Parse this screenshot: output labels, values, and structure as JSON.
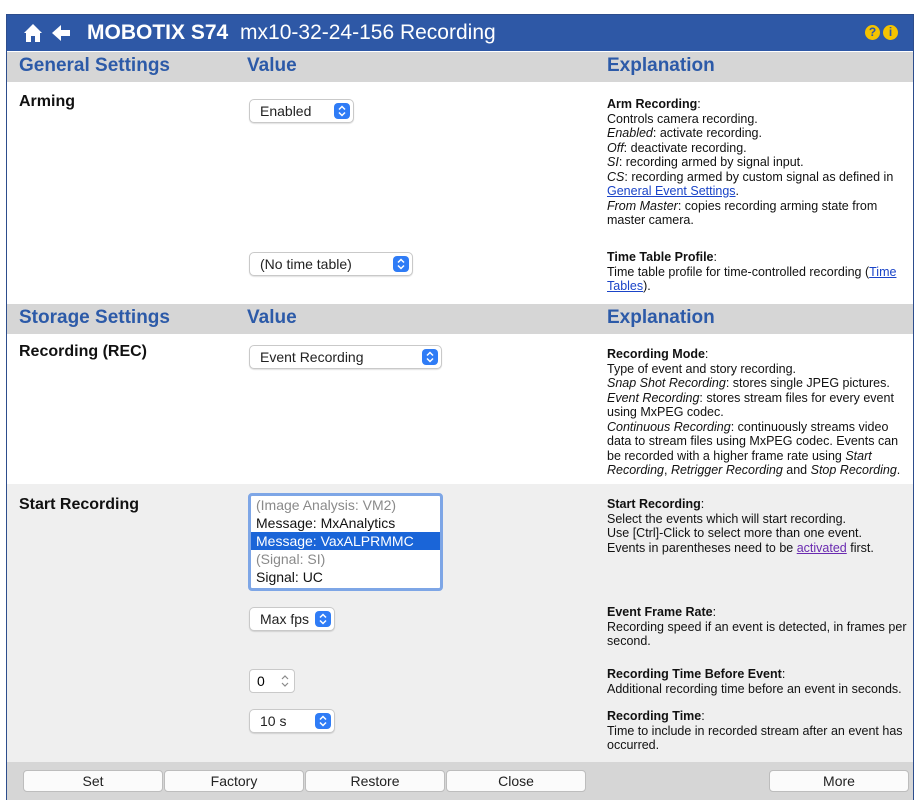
{
  "header": {
    "brand": "MOBOTIX S74",
    "page_title": "mx10-32-24-156 Recording",
    "help_icon_glyph": "?",
    "info_icon_glyph": "i"
  },
  "general_section": {
    "col1": "General Settings",
    "col2": "Value",
    "col3": "Explanation"
  },
  "arming": {
    "label": "Arming",
    "value": "Enabled",
    "time_table_value": "(No time table)"
  },
  "arming_expl": {
    "title": "Arm Recording",
    "line1": "Controls camera recording.",
    "enabled_term": "Enabled",
    "enabled_text": ": activate recording.",
    "off_term": "Off",
    "off_text": ": deactivate recording.",
    "si_term": "SI",
    "si_text": ": recording armed by signal input.",
    "cs_term": "CS",
    "cs_text": ": recording armed by custom signal as defined in",
    "cs_link": "General Event Settings",
    "master_term": "From Master",
    "master_text": ": copies recording arming state from master camera."
  },
  "timetable_expl": {
    "title": "Time Table Profile",
    "text": "Time table profile for time-controlled recording (",
    "link": "Time Tables",
    "tail": ")."
  },
  "storage_section": {
    "col1": "Storage Settings",
    "col2": "Value",
    "col3": "Explanation"
  },
  "recording": {
    "label": "Recording (REC)",
    "value": "Event Recording"
  },
  "recording_expl": {
    "title": "Recording Mode",
    "line1": "Type of event and story recording.",
    "snap_term": "Snap Shot Recording",
    "snap_text": ": stores single JPEG pictures.",
    "event_term": "Event Recording",
    "event_text": ": stores stream files for every event using MxPEG codec.",
    "cont_term": "Continuous Recording",
    "cont_text": ": continuously streams video data to stream files using MxPEG codec. Events can be recorded with a higher frame rate using ",
    "start_term": "Start Recording",
    "sep1": ", ",
    "retrigger_term": "Retrigger Recording",
    "and_text": " and ",
    "stop_term": "Stop Recording",
    "period": "."
  },
  "start_recording": {
    "label": "Start Recording",
    "options": [
      "(Image Analysis: VM2)",
      "Message: MxAnalytics",
      "Message: VaxALPRMMC",
      "(Signal: SI)",
      "Signal: UC"
    ],
    "frame_rate_value": "Max fps",
    "time_before_value": "0",
    "recording_time_value": "10 s"
  },
  "start_expl": {
    "title": "Start Recording",
    "line1": "Select the events which will start recording.",
    "line2": "Use [Ctrl]-Click to select more than one event.",
    "line3": "Events in parentheses need to be ",
    "link": "activated",
    "tail": " first."
  },
  "frame_rate_expl": {
    "title": "Event Frame Rate",
    "text": "Recording speed if an event is detected, in frames per second."
  },
  "time_before_expl": {
    "title": "Recording Time Before Event",
    "text": "Additional recording time before an event in seconds."
  },
  "recording_time_expl": {
    "title": "Recording Time",
    "text": "Time to include in recorded stream after an event has occurred."
  },
  "footer": {
    "set": "Set",
    "factory": "Factory",
    "restore": "Restore",
    "close": "Close",
    "more": "More"
  },
  "colors": {
    "titlebar": "#2e58a6",
    "section_header_bg": "#d6d6d6",
    "section_header_text": "#2c5aa8",
    "row_alt_bg": "#efefef",
    "select_accent": "#2f7cf6",
    "list_selection": "#1a65d8",
    "link": "#1a44c8",
    "visited_link": "#6a2ab0",
    "help_badge": "#f4c300"
  }
}
